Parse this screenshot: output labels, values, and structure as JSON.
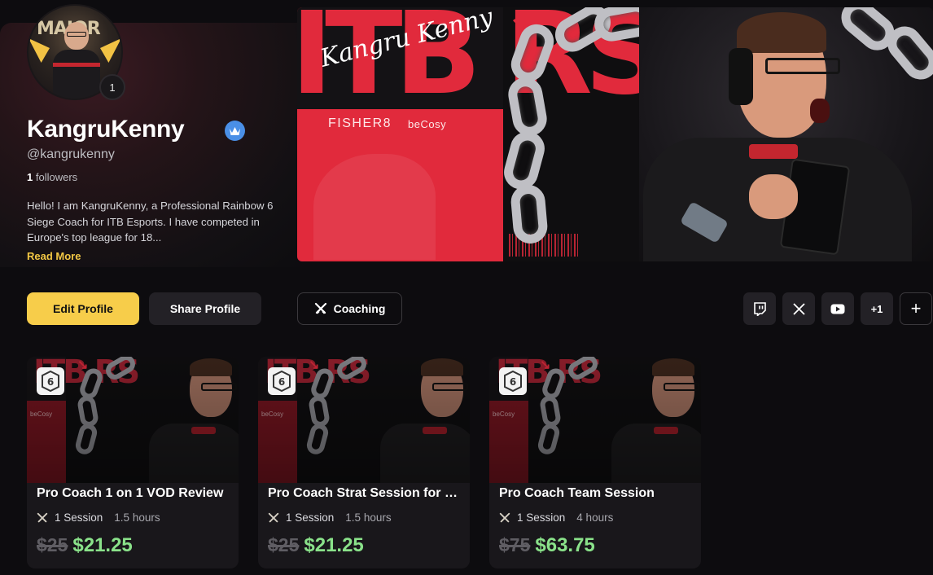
{
  "profile": {
    "username": "KangruKenny",
    "handle": "@kangrukenny",
    "followers_count": "1",
    "followers_label": "followers",
    "level": "1",
    "bio": "Hello! I am KangruKenny, a Professional Rainbow 6 Siege Coach for ITB Esports. I have competed in Europe's top league for 18...",
    "read_more": "Read More",
    "verified": true
  },
  "banner": {
    "signature": "Kangru Kenny",
    "brand_text": "ITB RS",
    "sponsor_1": "FISHER8",
    "sponsor_2": "beCosy"
  },
  "actions": {
    "edit_profile": "Edit Profile",
    "share_profile": "Share Profile",
    "coaching": "Coaching"
  },
  "socials": {
    "items": [
      {
        "name": "twitch",
        "icon": "twitch-icon"
      },
      {
        "name": "x",
        "icon": "x-icon"
      },
      {
        "name": "youtube",
        "icon": "youtube-icon"
      }
    ],
    "more_count": "+1",
    "add": "+"
  },
  "services": [
    {
      "title": "Pro Coach 1 on 1 VOD Review",
      "sessions": "1 Session",
      "duration": "1.5 hours",
      "old_price": "$25",
      "new_price": "$21.25",
      "game_icon": "rainbow-six-siege-icon"
    },
    {
      "title": "Pro Coach Strat Session for C...",
      "sessions": "1 Session",
      "duration": "1.5 hours",
      "old_price": "$25",
      "new_price": "$21.25",
      "game_icon": "rainbow-six-siege-icon"
    },
    {
      "title": "Pro Coach Team Session",
      "sessions": "1 Session",
      "duration": "4 hours",
      "old_price": "$75",
      "new_price": "$63.75",
      "game_icon": "rainbow-six-siege-icon"
    }
  ],
  "colors": {
    "accent": "#f7cd4a",
    "sale_price": "#8ae28a",
    "verified": "#4a8fe6",
    "brand_red": "#e12a3c"
  }
}
